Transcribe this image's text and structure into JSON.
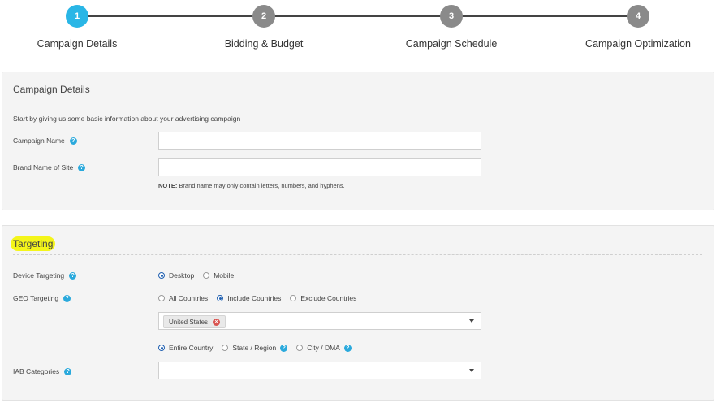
{
  "stepper": {
    "steps": [
      {
        "number": "1",
        "label": "Campaign Details",
        "active": true
      },
      {
        "number": "2",
        "label": "Bidding & Budget",
        "active": false
      },
      {
        "number": "3",
        "label": "Campaign Schedule",
        "active": false
      },
      {
        "number": "4",
        "label": "Campaign Optimization",
        "active": false
      }
    ]
  },
  "campaign_details": {
    "title": "Campaign Details",
    "intro": "Start by giving us some basic information about your advertising campaign",
    "campaign_name_label": "Campaign Name",
    "campaign_name_value": "",
    "brand_name_label": "Brand Name of Site",
    "brand_name_value": "",
    "note_prefix": "NOTE:",
    "note_text": " Brand name may only contain letters, numbers, and hyphens."
  },
  "targeting": {
    "title": "Targeting",
    "device_label": "Device Targeting",
    "device_options": [
      "Desktop",
      "Mobile"
    ],
    "device_selected": "Desktop",
    "geo_label": "GEO Targeting",
    "geo_options": [
      "All Countries",
      "Include Countries",
      "Exclude Countries"
    ],
    "geo_selected": "Include Countries",
    "geo_tag": "United States",
    "scope_options": [
      "Entire Country",
      "State / Region",
      "City / DMA"
    ],
    "scope_selected": "Entire Country",
    "iab_label": "IAB Categories",
    "iab_value": ""
  },
  "colors": {
    "active_step": "#29b6e6",
    "inactive_step": "#8a8a8a",
    "help_icon": "#2aa9dc",
    "highlight": "#f4f51a"
  }
}
